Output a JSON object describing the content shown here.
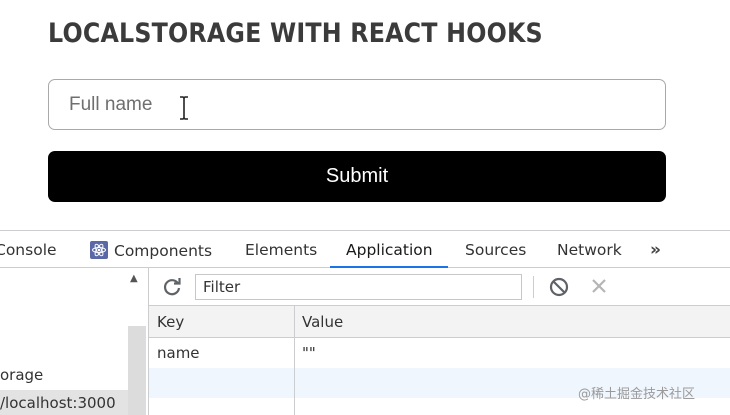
{
  "app": {
    "title": "LOCALSTORAGE WITH REACT HOOKS",
    "name_input": {
      "placeholder": "Full name",
      "value": ""
    },
    "submit_label": "Submit"
  },
  "devtools": {
    "tabs": [
      {
        "label": "Console"
      },
      {
        "label": "Components",
        "icon": "react-icon"
      },
      {
        "label": "Elements"
      },
      {
        "label": "Application",
        "active": true
      },
      {
        "label": "Sources"
      },
      {
        "label": "Network"
      }
    ],
    "more_tabs_label": "»",
    "sidebar": {
      "items": [
        {
          "label": "orage"
        },
        {
          "label": "/localhost:3000",
          "selected": true
        }
      ]
    },
    "toolbar": {
      "filter_placeholder": "Filter"
    },
    "storage_table": {
      "columns": [
        "Key",
        "Value"
      ],
      "rows": [
        {
          "key": "name",
          "value": "\"\""
        }
      ]
    }
  },
  "watermark": "@稀土掘金技术社区"
}
